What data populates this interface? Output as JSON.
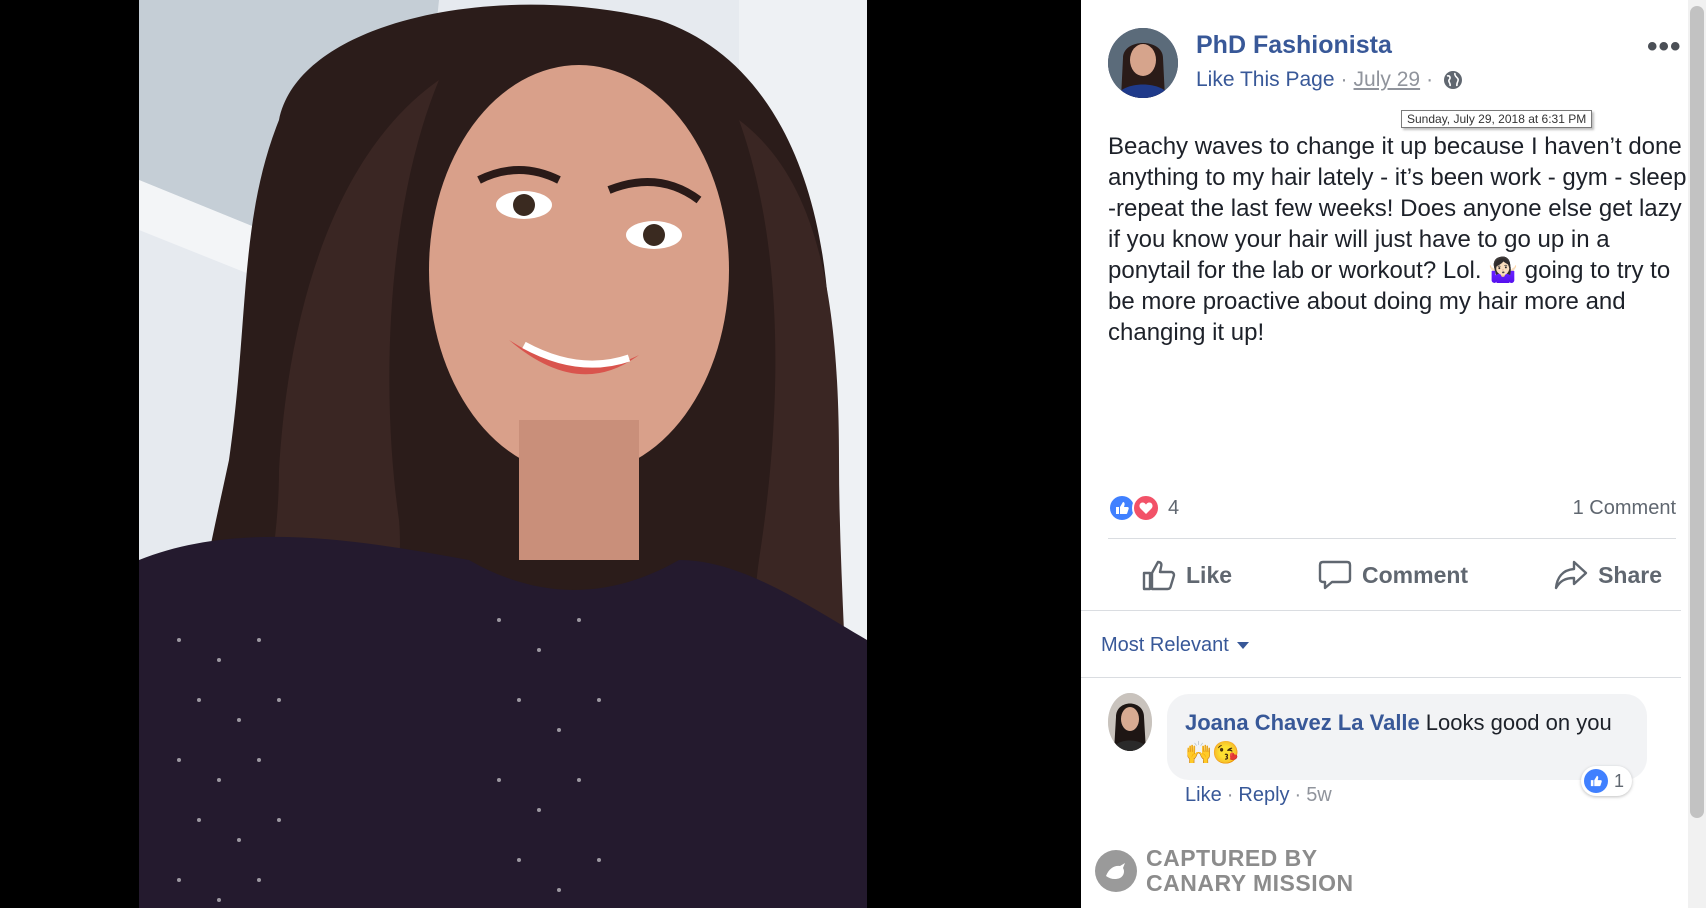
{
  "post": {
    "page_name": "PhD Fashionista",
    "like_page": "Like This Page",
    "date": "July 29",
    "date_tooltip": "Sunday, July 29, 2018 at 6:31 PM",
    "more": "•••",
    "text": "Beachy waves to change it up because I haven’t done anything to my hair lately - it’s been work - gym - sleep -repeat the last few weeks! Does anyone else get lazy if you know your hair will just have to go up in a ponytail for the lab or workout? Lol. 🤷🏻‍♀️ going to try to be more proactive about doing my hair more and changing it up!",
    "reaction_count": "4",
    "comment_count": "1 Comment"
  },
  "actions": {
    "like": "Like",
    "comment": "Comment",
    "share": "Share"
  },
  "comments_sort": "Most Relevant",
  "comment": {
    "author": "Joana Chavez La Valle",
    "text": "Looks good on you 🙌😘",
    "reaction_count": "1",
    "like": "Like",
    "reply": "Reply",
    "time": "5w"
  },
  "watermark": {
    "line1": "CAPTURED BY",
    "line2": "CANARY MISSION"
  },
  "colors": {
    "link": "#385898",
    "like_blue": "#4080ff",
    "love_red": "#f25268"
  }
}
